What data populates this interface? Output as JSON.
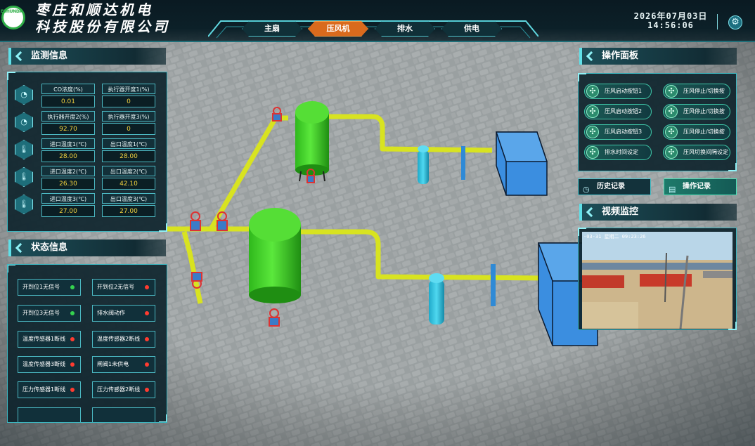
{
  "header": {
    "logo_text": "ESHUNDA",
    "company_line1": "枣庄和顺达机电",
    "company_line2": "科技股份有限公司",
    "date": "2026年07月03日",
    "time": "14:56:06",
    "settings_icon": "gear-icon"
  },
  "nav": {
    "items": [
      {
        "label": "主扇",
        "active": false
      },
      {
        "label": "压风机",
        "active": true
      },
      {
        "label": "排水",
        "active": false
      },
      {
        "label": "供电",
        "active": false
      }
    ]
  },
  "monitor": {
    "title": "监测信息",
    "rows": [
      {
        "icon": "gauge-icon",
        "cells": [
          {
            "label": "CO浓度(%)",
            "value": "0.01"
          },
          {
            "label": "执行器开度1(%)",
            "value": "0"
          }
        ]
      },
      {
        "icon": "gauge-icon",
        "cells": [
          {
            "label": "执行器开度2(%)",
            "value": "92.70"
          },
          {
            "label": "执行器开度3(%)",
            "value": "0"
          }
        ]
      },
      {
        "icon": "thermometer-icon",
        "cells": [
          {
            "label": "进口温度1(℃)",
            "value": "28.00"
          },
          {
            "label": "出口温度1(℃)",
            "value": "28.00"
          }
        ]
      },
      {
        "icon": "thermometer-icon",
        "cells": [
          {
            "label": "进口温度2(℃)",
            "value": "26.30"
          },
          {
            "label": "出口温度2(℃)",
            "value": "42.10"
          }
        ]
      },
      {
        "icon": "thermometer-icon",
        "cells": [
          {
            "label": "进口温度3(℃)",
            "value": "27.00"
          },
          {
            "label": "出口温度3(℃)",
            "value": "27.00"
          }
        ]
      }
    ]
  },
  "status": {
    "title": "状态信息",
    "items": [
      {
        "label": "开到位1无信号",
        "state": "ok"
      },
      {
        "label": "开到位2无信号",
        "state": "alarm"
      },
      {
        "label": "开到位3无信号",
        "state": "ok"
      },
      {
        "label": "排水阀动作",
        "state": "alarm"
      },
      {
        "label": "温度传感器1断线",
        "state": "alarm"
      },
      {
        "label": "温度传感器2断线",
        "state": "alarm"
      },
      {
        "label": "温度传感器3断线",
        "state": "alarm"
      },
      {
        "label": "闸阀1未供电",
        "state": "alarm"
      },
      {
        "label": "压力传感器1断线",
        "state": "alarm"
      },
      {
        "label": "压力传感器2断线",
        "state": "alarm"
      }
    ],
    "colors": {
      "ok": "#35d24f",
      "alarm": "#ff3b30"
    }
  },
  "operation": {
    "title": "操作面板",
    "buttons": [
      {
        "label": "压风启动按钮1",
        "icon": "fan-icon"
      },
      {
        "label": "压风停止/切换按",
        "icon": "fan-icon"
      },
      {
        "label": "压风启动按钮2",
        "icon": "fan-icon"
      },
      {
        "label": "压风停止/切换按",
        "icon": "fan-icon"
      },
      {
        "label": "压风启动按钮3",
        "icon": "fan-icon"
      },
      {
        "label": "压风停止/切换按",
        "icon": "fan-icon"
      },
      {
        "label": "排水时间设定",
        "icon": "fan-icon"
      },
      {
        "label": "压风切换间隔设定",
        "icon": "fan-icon"
      }
    ]
  },
  "records": {
    "history_label": "历史记录",
    "history_icon": "clock-icon",
    "operation_label": "操作记录",
    "operation_icon": "document-icon"
  },
  "video": {
    "title": "视频监控",
    "timestamp": "-03-31 星期二 09:23:26"
  }
}
